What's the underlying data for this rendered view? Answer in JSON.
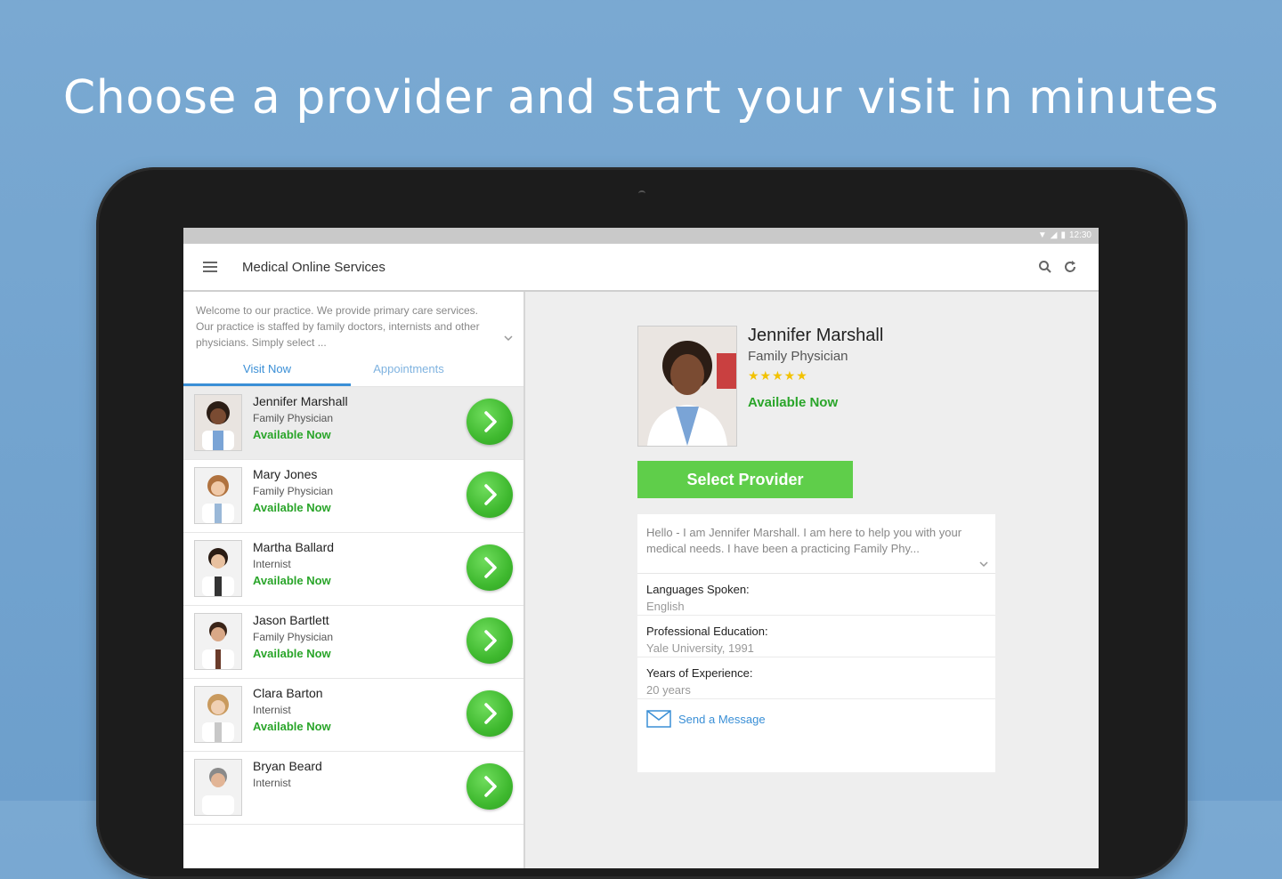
{
  "headline": "Choose a provider and start your visit in minutes",
  "app": {
    "title": "Medical Online Services",
    "status_time": "12:30"
  },
  "intro_text": "Welcome to our practice. We provide primary care services. Our practice is staffed by family doctors, internists and other physicians. Simply select ...",
  "tabs": [
    {
      "label": "Visit Now",
      "active": true
    },
    {
      "label": "Appointments",
      "active": false
    }
  ],
  "providers": [
    {
      "name": "Jennifer Marshall",
      "role": "Family Physician",
      "status": "Available Now",
      "selected": true
    },
    {
      "name": "Mary Jones",
      "role": "Family Physician",
      "status": "Available Now",
      "selected": false
    },
    {
      "name": "Martha Ballard",
      "role": "Internist",
      "status": "Available Now",
      "selected": false
    },
    {
      "name": "Jason Bartlett",
      "role": "Family Physician",
      "status": "Available Now",
      "selected": false
    },
    {
      "name": "Clara Barton",
      "role": "Internist",
      "status": "Available Now",
      "selected": false
    },
    {
      "name": "Bryan Beard",
      "role": "Internist",
      "status": "",
      "selected": false
    }
  ],
  "detail": {
    "name": "Jennifer Marshall",
    "role": "Family Physician",
    "stars": "★★★★★",
    "rating": 5,
    "status": "Available Now",
    "select_label": "Select Provider",
    "bio": "Hello - I am Jennifer Marshall. I am here to help you with your medical needs. I have been a practicing Family Phy...",
    "info": [
      {
        "label": "Languages Spoken:",
        "value": "English"
      },
      {
        "label": "Professional Education:",
        "value": "Yale University, 1991"
      },
      {
        "label": "Years of Experience:",
        "value": "20 years"
      }
    ],
    "message_label": "Send a Message"
  },
  "colors": {
    "background": "#7aa9d2",
    "accent_blue": "#3a8fd6",
    "available_green": "#2aa52a",
    "button_green": "#5fce4a",
    "star_gold": "#f2c200"
  }
}
